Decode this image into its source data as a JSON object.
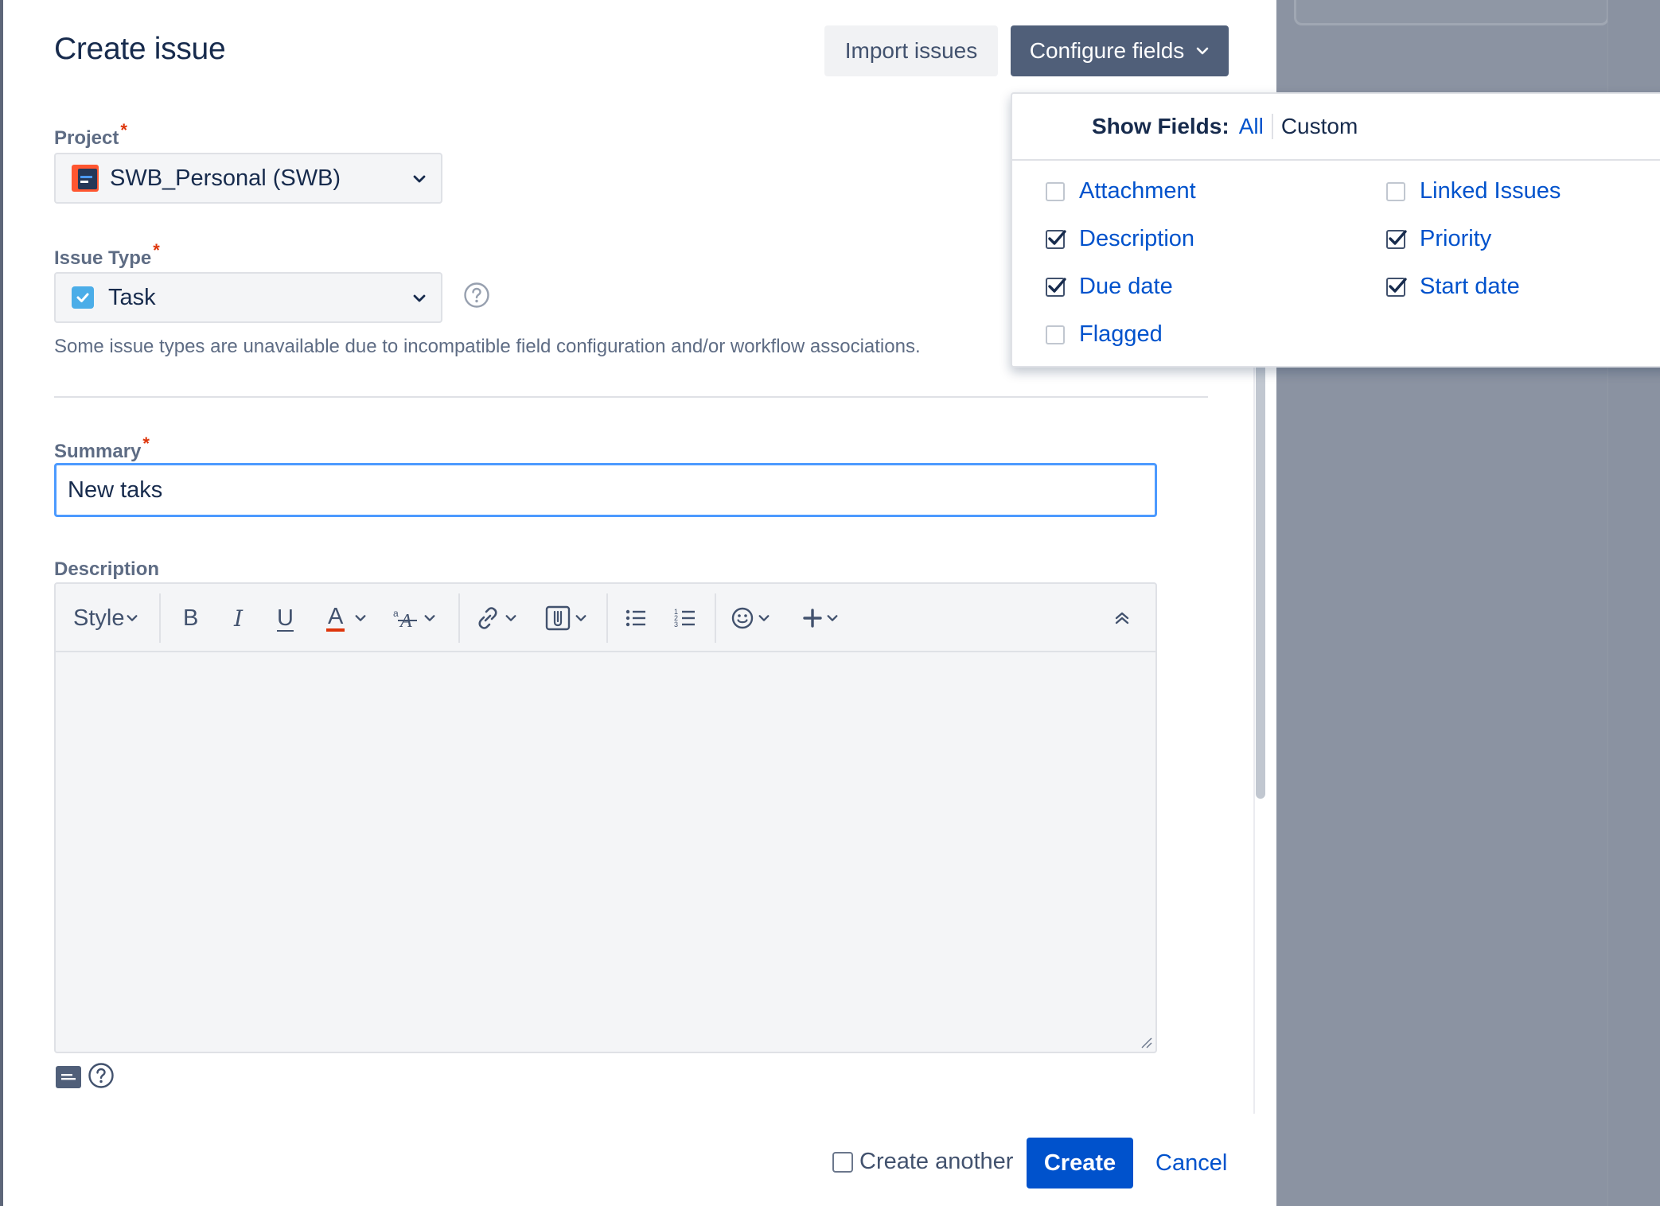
{
  "dialog": {
    "title": "Create issue",
    "import_label": "Import issues",
    "configure_label": "Configure fields"
  },
  "project": {
    "label": "Project",
    "required_mark": "*",
    "value": "SWB_Personal (SWB)"
  },
  "issue_type": {
    "label": "Issue Type",
    "required_mark": "*",
    "value": "Task",
    "note": "Some issue types are unavailable due to incompatible field configuration and/or workflow associations."
  },
  "summary": {
    "label": "Summary",
    "required_mark": "*",
    "value": "New taks"
  },
  "description": {
    "label": "Description",
    "toolbar": {
      "style_label": "Style",
      "bold": "B",
      "italic": "I",
      "underline": "U",
      "text_color": "A"
    }
  },
  "footer": {
    "create_another_label": "Create another",
    "create_label": "Create",
    "cancel_label": "Cancel"
  },
  "show_fields": {
    "label": "Show Fields:",
    "all_label": "All",
    "custom_label": "Custom",
    "items": [
      {
        "label": "Attachment",
        "checked": false
      },
      {
        "label": "Linked Issues",
        "checked": false
      },
      {
        "label": "Description",
        "checked": true
      },
      {
        "label": "Priority",
        "checked": true
      },
      {
        "label": "Due date",
        "checked": true
      },
      {
        "label": "Start date",
        "checked": true
      },
      {
        "label": "Flagged",
        "checked": false
      }
    ]
  },
  "colors": {
    "primary": "#0052cc",
    "configure_bg": "#505f79",
    "focus_border": "#4c9aff",
    "required": "#de350b",
    "task_icon": "#4bade8"
  }
}
